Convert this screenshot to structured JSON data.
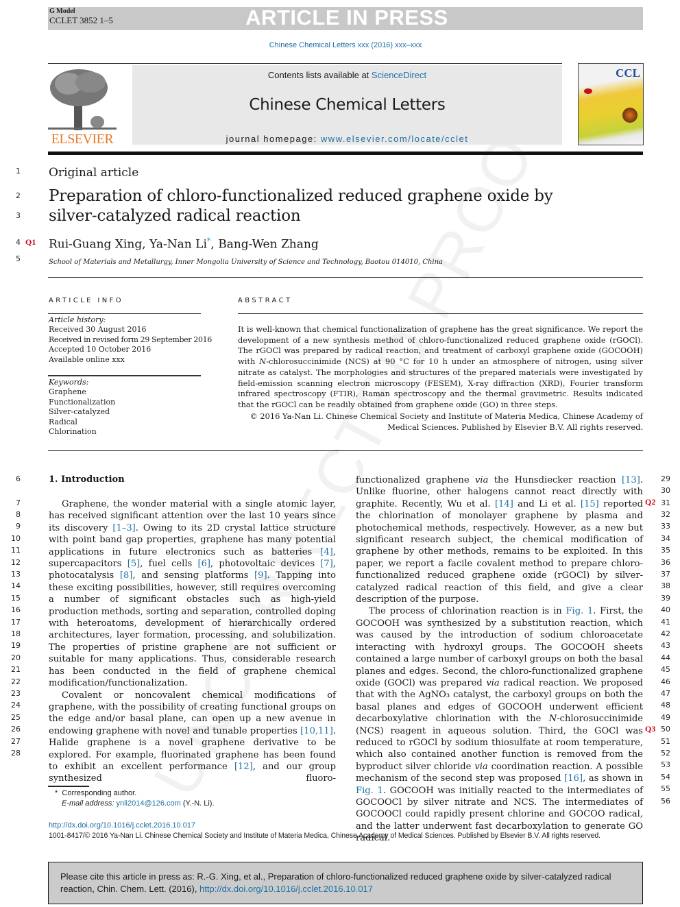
{
  "header": {
    "g_model": "G Model",
    "article_code": "CCLET 3852 1–5",
    "banner": "ARTICLE IN PRESS",
    "journal_ref": "Chinese Chemical Letters xxx (2016) xxx–xxx",
    "contents_prefix": "Contents lists available at ",
    "contents_link": "ScienceDirect",
    "journal_title": "Chinese Chemical Letters",
    "homepage_prefix": "journal homepage: ",
    "homepage_link": "www.elsevier.com/locate/cclet",
    "publisher_logo_text": "ELSEVIER",
    "cover_title": "CCL"
  },
  "watermark": "UNCORRECTED PROOF",
  "article": {
    "type": "Original article",
    "title_line1": "Preparation of chloro-functionalized reduced graphene oxide by",
    "title_line2": "silver-catalyzed radical reaction",
    "authors_part1": "Rui-Guang Xing, Ya-Nan Li",
    "author_mark": "*",
    "authors_part2": ", Bang-Wen Zhang",
    "affiliation": "School of Materials and Metallurgy, Inner Mongolia University of Science and Technology, Baotou 014010, China"
  },
  "query_marks": {
    "q1": "Q1",
    "q2": "Q2",
    "q3": "Q3"
  },
  "line_numbers": {
    "left": [
      "1",
      "2",
      "3",
      "4",
      "5",
      "6",
      "7",
      "8",
      "9",
      "10",
      "11",
      "12",
      "13",
      "14",
      "15",
      "16",
      "17",
      "18",
      "19",
      "20",
      "21",
      "22",
      "23",
      "24",
      "25",
      "26",
      "27",
      "28"
    ],
    "right": [
      "29",
      "30",
      "31",
      "32",
      "33",
      "34",
      "35",
      "36",
      "37",
      "38",
      "39",
      "40",
      "41",
      "42",
      "43",
      "44",
      "45",
      "46",
      "47",
      "48",
      "49",
      "50",
      "51",
      "52",
      "53",
      "54",
      "55",
      "56"
    ]
  },
  "article_info": {
    "heading": "ARTICLE INFO",
    "history_label": "Article history:",
    "history": [
      "Received 30 August 2016",
      "Received in revised form 29 September 2016",
      "Accepted 10 October 2016",
      "Available online xxx"
    ],
    "keywords_label": "Keywords:",
    "keywords": [
      "Graphene",
      "Functionalization",
      "Silver-catalyzed",
      "Radical",
      "Chlorination"
    ]
  },
  "abstract": {
    "heading": "ABSTRACT",
    "text_a": "It is well-known that chemical functionalization of graphene has the great significance. We report the development of a new synthesis method of chloro-functionalized reduced graphene oxide (rGOCl). The rGOCl was prepared by radical reaction, and treatment of carboxyl graphene oxide (GOCOOH) with ",
    "text_italic": "N",
    "text_b": "-chlorosuccinimide (NCS) at 90 °C for 10 h under an atmosphere of nitrogen, using silver nitrate as catalyst. The morphologies and structures of the prepared materials were investigated by field-emission scanning electron microscopy (FESEM), X-ray diffraction (XRD), Fourier transform infrared spectroscopy (FTIR), Raman spectroscopy and the thermal gravimetric. Results indicated that the rGOCl can be readily obtained from graphene oxide (GO) in three steps.",
    "copyright_line1": "© 2016 Ya-Nan Li. Chinese Chemical Society and Institute of Materia Medica, Chinese Academy of",
    "copyright_line2": "Medical Sciences. Published by Elsevier B.V. All rights reserved."
  },
  "introduction": {
    "heading": "1. Introduction",
    "p1": [
      {
        "t": "Graphene, the wonder material with a single atomic layer, has received significant attention over the last 10 years since its discovery "
      },
      {
        "t": "[1–3]",
        "link": true
      },
      {
        "t": ". Owing to its 2D crystal lattice structure with point band gap properties, graphene has many potential applications in future electronics such as batteries "
      },
      {
        "t": "[4]",
        "link": true
      },
      {
        "t": ", supercapacitors "
      },
      {
        "t": "[5]",
        "link": true
      },
      {
        "t": ", fuel cells "
      },
      {
        "t": "[6]",
        "link": true
      },
      {
        "t": ", photovoltaic devices "
      },
      {
        "t": "[7]",
        "link": true
      },
      {
        "t": ", photocatalysis "
      },
      {
        "t": "[8]",
        "link": true
      },
      {
        "t": ", and sensing platforms "
      },
      {
        "t": "[9]",
        "link": true
      },
      {
        "t": ". Tapping into these exciting possibilities, however, still requires overcoming a number of significant obstacles such as high-yield production methods, sorting and separation, controlled doping with heteroatoms, development of hierarchically ordered architectures, layer formation, processing, and solubilization. The properties of pristine graphene are not sufficient or suitable for many applications. Thus, considerable research has been conducted in the field of graphene chemical modification/functionalization."
      }
    ],
    "p2": [
      {
        "t": "Covalent or noncovalent chemical modifications of graphene, with the possibility of creating functional groups on the edge and/or basal plane, can open up a new avenue in endowing graphene with novel and tunable properties "
      },
      {
        "t": "[10,11]",
        "link": true
      },
      {
        "t": ". Halide graphene is a novel graphene derivative to be explored. For example, fluorinated graphene has been found to exhibit an excellent performance "
      },
      {
        "t": "[12]",
        "link": true
      },
      {
        "t": ", and our group synthesized fluoro-functionalized graphene "
      },
      {
        "t": "via",
        "italic": true
      },
      {
        "t": " the Hunsdiecker reaction "
      },
      {
        "t": "[13]",
        "link": true
      },
      {
        "t": ". Unlike fluorine, other halogens cannot react directly with graphite. Recently, Wu et al. "
      },
      {
        "t": "[14]",
        "link": true
      },
      {
        "t": " and Li et al. "
      },
      {
        "t": "[15]",
        "link": true
      },
      {
        "t": " reported the chlorination of monolayer graphene by plasma and photochemical methods, respectively. However, as a new but significant research subject, the chemical modification of graphene by other methods, remains to be exploited. In this paper, we report a facile covalent method to prepare chloro-functionalized reduced graphene oxide (rGOCl) by silver-catalyzed radical reaction of this field, and give a clear description of the purpose."
      }
    ],
    "p3": [
      {
        "t": "The process of chlorination reaction is in "
      },
      {
        "t": "Fig. 1",
        "link": true
      },
      {
        "t": ". First, the GOCOOH was synthesized by a substitution reaction, which was caused by the introduction of sodium chloroacetate interacting with hydroxyl groups. The GOCOOH sheets contained a large number of carboxyl groups on both the basal planes and edges. Second, the chloro-functionalized graphene oxide (GOCl) was prepared "
      },
      {
        "t": "via",
        "italic": true
      },
      {
        "t": " radical reaction. We proposed that with the AgNO₃ catalyst, the carboxyl groups on both the basal planes and edges of GOCOOH underwent efficient decarboxylative chlorination with the "
      },
      {
        "t": "N",
        "italic": true
      },
      {
        "t": "-chlorosuccinimide (NCS) reagent in aqueous solution. Third, the GOCl was reduced to rGOCl by sodium thiosulfate at room temperature, which also contained another function is removed from the byproduct silver chloride "
      },
      {
        "t": "via",
        "italic": true
      },
      {
        "t": " coordination reaction. A possible mechanism of the second step was proposed "
      },
      {
        "t": "[16]",
        "link": true
      },
      {
        "t": ", as shown in "
      },
      {
        "t": "Fig. 1",
        "link": true
      },
      {
        "t": ". GOCOOH was initially reacted to the intermediates of GOCOOCl by silver nitrate and NCS. The intermediates of GOCOOCl could rapidly present chlorine and GOCOO radical, and the latter underwent fast decarboxylation to generate GO radical."
      }
    ]
  },
  "footnote": {
    "mark": "*",
    "corresponding": "Corresponding author.",
    "email_label": "E-mail address:",
    "email": "ynli2014@126.com",
    "email_suffix": "(Y.-N. Li)."
  },
  "footer": {
    "doi": "http://dx.doi.org/10.1016/j.cclet.2016.10.017",
    "issn_line": "1001-8417/© 2016 Ya-Nan Li. Chinese Chemical Society and Institute of Materia Medica, Chinese Academy of Medical Sciences. Published by Elsevier B.V. All rights reserved."
  },
  "citation": {
    "text": "Please cite this article in press as: R.-G. Xing, et al., Preparation of chloro-functionalized reduced graphene oxide by silver-catalyzed radical reaction, Chin. Chem. Lett. (2016), ",
    "link": "http://dx.doi.org/10.1016/j.cclet.2016.10.017"
  }
}
